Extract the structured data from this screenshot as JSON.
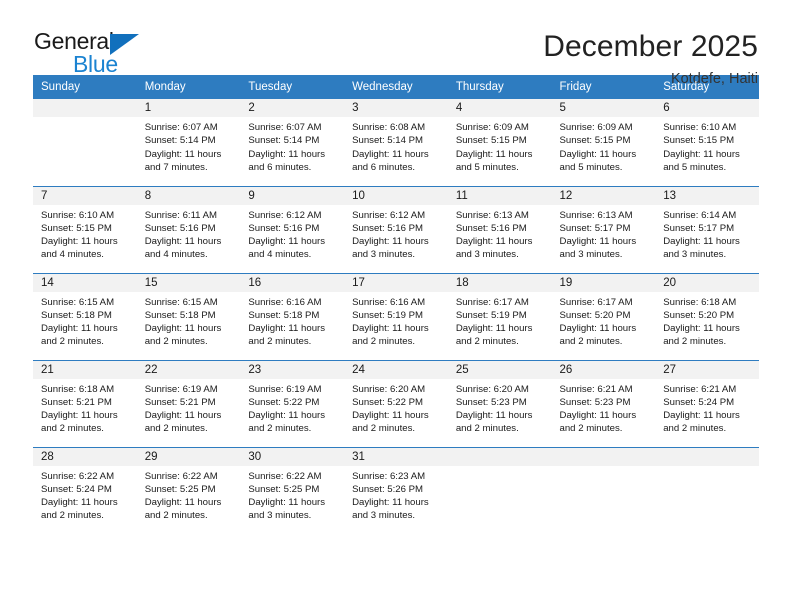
{
  "brand": {
    "name_top": "General",
    "name_bottom": "Blue",
    "triangle_color": "#1170bd",
    "blue_color": "#1b83d1"
  },
  "header": {
    "title": "December 2025",
    "subtitle": "Kotdefe, Haiti"
  },
  "theme": {
    "header_bg": "#2e7cc0",
    "header_text": "#ffffff",
    "daynum_bg": "#f2f2f2",
    "row_border": "#2e7cc0"
  },
  "weekday_headers": [
    "Sunday",
    "Monday",
    "Tuesday",
    "Wednesday",
    "Thursday",
    "Friday",
    "Saturday"
  ],
  "weeks": [
    [
      {
        "day": "",
        "sunrise": "",
        "sunset": "",
        "daylight_1": "",
        "daylight_2": ""
      },
      {
        "day": "1",
        "sunrise": "Sunrise: 6:07 AM",
        "sunset": "Sunset: 5:14 PM",
        "daylight_1": "Daylight: 11 hours",
        "daylight_2": "and 7 minutes."
      },
      {
        "day": "2",
        "sunrise": "Sunrise: 6:07 AM",
        "sunset": "Sunset: 5:14 PM",
        "daylight_1": "Daylight: 11 hours",
        "daylight_2": "and 6 minutes."
      },
      {
        "day": "3",
        "sunrise": "Sunrise: 6:08 AM",
        "sunset": "Sunset: 5:14 PM",
        "daylight_1": "Daylight: 11 hours",
        "daylight_2": "and 6 minutes."
      },
      {
        "day": "4",
        "sunrise": "Sunrise: 6:09 AM",
        "sunset": "Sunset: 5:15 PM",
        "daylight_1": "Daylight: 11 hours",
        "daylight_2": "and 5 minutes."
      },
      {
        "day": "5",
        "sunrise": "Sunrise: 6:09 AM",
        "sunset": "Sunset: 5:15 PM",
        "daylight_1": "Daylight: 11 hours",
        "daylight_2": "and 5 minutes."
      },
      {
        "day": "6",
        "sunrise": "Sunrise: 6:10 AM",
        "sunset": "Sunset: 5:15 PM",
        "daylight_1": "Daylight: 11 hours",
        "daylight_2": "and 5 minutes."
      }
    ],
    [
      {
        "day": "7",
        "sunrise": "Sunrise: 6:10 AM",
        "sunset": "Sunset: 5:15 PM",
        "daylight_1": "Daylight: 11 hours",
        "daylight_2": "and 4 minutes."
      },
      {
        "day": "8",
        "sunrise": "Sunrise: 6:11 AM",
        "sunset": "Sunset: 5:16 PM",
        "daylight_1": "Daylight: 11 hours",
        "daylight_2": "and 4 minutes."
      },
      {
        "day": "9",
        "sunrise": "Sunrise: 6:12 AM",
        "sunset": "Sunset: 5:16 PM",
        "daylight_1": "Daylight: 11 hours",
        "daylight_2": "and 4 minutes."
      },
      {
        "day": "10",
        "sunrise": "Sunrise: 6:12 AM",
        "sunset": "Sunset: 5:16 PM",
        "daylight_1": "Daylight: 11 hours",
        "daylight_2": "and 3 minutes."
      },
      {
        "day": "11",
        "sunrise": "Sunrise: 6:13 AM",
        "sunset": "Sunset: 5:16 PM",
        "daylight_1": "Daylight: 11 hours",
        "daylight_2": "and 3 minutes."
      },
      {
        "day": "12",
        "sunrise": "Sunrise: 6:13 AM",
        "sunset": "Sunset: 5:17 PM",
        "daylight_1": "Daylight: 11 hours",
        "daylight_2": "and 3 minutes."
      },
      {
        "day": "13",
        "sunrise": "Sunrise: 6:14 AM",
        "sunset": "Sunset: 5:17 PM",
        "daylight_1": "Daylight: 11 hours",
        "daylight_2": "and 3 minutes."
      }
    ],
    [
      {
        "day": "14",
        "sunrise": "Sunrise: 6:15 AM",
        "sunset": "Sunset: 5:18 PM",
        "daylight_1": "Daylight: 11 hours",
        "daylight_2": "and 2 minutes."
      },
      {
        "day": "15",
        "sunrise": "Sunrise: 6:15 AM",
        "sunset": "Sunset: 5:18 PM",
        "daylight_1": "Daylight: 11 hours",
        "daylight_2": "and 2 minutes."
      },
      {
        "day": "16",
        "sunrise": "Sunrise: 6:16 AM",
        "sunset": "Sunset: 5:18 PM",
        "daylight_1": "Daylight: 11 hours",
        "daylight_2": "and 2 minutes."
      },
      {
        "day": "17",
        "sunrise": "Sunrise: 6:16 AM",
        "sunset": "Sunset: 5:19 PM",
        "daylight_1": "Daylight: 11 hours",
        "daylight_2": "and 2 minutes."
      },
      {
        "day": "18",
        "sunrise": "Sunrise: 6:17 AM",
        "sunset": "Sunset: 5:19 PM",
        "daylight_1": "Daylight: 11 hours",
        "daylight_2": "and 2 minutes."
      },
      {
        "day": "19",
        "sunrise": "Sunrise: 6:17 AM",
        "sunset": "Sunset: 5:20 PM",
        "daylight_1": "Daylight: 11 hours",
        "daylight_2": "and 2 minutes."
      },
      {
        "day": "20",
        "sunrise": "Sunrise: 6:18 AM",
        "sunset": "Sunset: 5:20 PM",
        "daylight_1": "Daylight: 11 hours",
        "daylight_2": "and 2 minutes."
      }
    ],
    [
      {
        "day": "21",
        "sunrise": "Sunrise: 6:18 AM",
        "sunset": "Sunset: 5:21 PM",
        "daylight_1": "Daylight: 11 hours",
        "daylight_2": "and 2 minutes."
      },
      {
        "day": "22",
        "sunrise": "Sunrise: 6:19 AM",
        "sunset": "Sunset: 5:21 PM",
        "daylight_1": "Daylight: 11 hours",
        "daylight_2": "and 2 minutes."
      },
      {
        "day": "23",
        "sunrise": "Sunrise: 6:19 AM",
        "sunset": "Sunset: 5:22 PM",
        "daylight_1": "Daylight: 11 hours",
        "daylight_2": "and 2 minutes."
      },
      {
        "day": "24",
        "sunrise": "Sunrise: 6:20 AM",
        "sunset": "Sunset: 5:22 PM",
        "daylight_1": "Daylight: 11 hours",
        "daylight_2": "and 2 minutes."
      },
      {
        "day": "25",
        "sunrise": "Sunrise: 6:20 AM",
        "sunset": "Sunset: 5:23 PM",
        "daylight_1": "Daylight: 11 hours",
        "daylight_2": "and 2 minutes."
      },
      {
        "day": "26",
        "sunrise": "Sunrise: 6:21 AM",
        "sunset": "Sunset: 5:23 PM",
        "daylight_1": "Daylight: 11 hours",
        "daylight_2": "and 2 minutes."
      },
      {
        "day": "27",
        "sunrise": "Sunrise: 6:21 AM",
        "sunset": "Sunset: 5:24 PM",
        "daylight_1": "Daylight: 11 hours",
        "daylight_2": "and 2 minutes."
      }
    ],
    [
      {
        "day": "28",
        "sunrise": "Sunrise: 6:22 AM",
        "sunset": "Sunset: 5:24 PM",
        "daylight_1": "Daylight: 11 hours",
        "daylight_2": "and 2 minutes."
      },
      {
        "day": "29",
        "sunrise": "Sunrise: 6:22 AM",
        "sunset": "Sunset: 5:25 PM",
        "daylight_1": "Daylight: 11 hours",
        "daylight_2": "and 2 minutes."
      },
      {
        "day": "30",
        "sunrise": "Sunrise: 6:22 AM",
        "sunset": "Sunset: 5:25 PM",
        "daylight_1": "Daylight: 11 hours",
        "daylight_2": "and 3 minutes."
      },
      {
        "day": "31",
        "sunrise": "Sunrise: 6:23 AM",
        "sunset": "Sunset: 5:26 PM",
        "daylight_1": "Daylight: 11 hours",
        "daylight_2": "and 3 minutes."
      },
      {
        "day": "",
        "sunrise": "",
        "sunset": "",
        "daylight_1": "",
        "daylight_2": ""
      },
      {
        "day": "",
        "sunrise": "",
        "sunset": "",
        "daylight_1": "",
        "daylight_2": ""
      },
      {
        "day": "",
        "sunrise": "",
        "sunset": "",
        "daylight_1": "",
        "daylight_2": ""
      }
    ]
  ]
}
